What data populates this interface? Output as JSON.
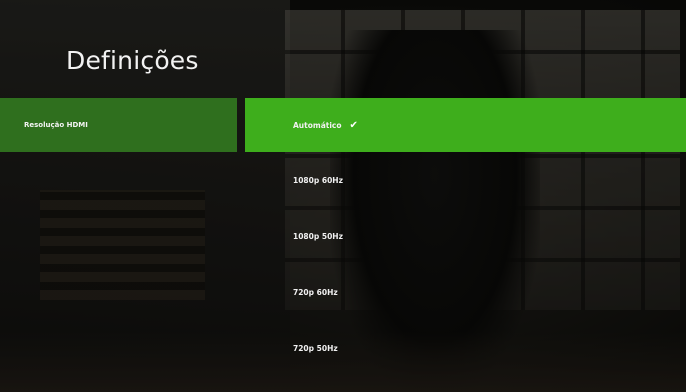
{
  "page": {
    "title": "Definições"
  },
  "settings": {
    "category_label": "Resolução HDMI"
  },
  "resolution_options": [
    {
      "label": "Automático",
      "selected": true
    },
    {
      "label": "1080p 60Hz",
      "selected": false
    },
    {
      "label": "1080p 50Hz",
      "selected": false
    },
    {
      "label": "720p 60Hz",
      "selected": false
    },
    {
      "label": "720p 50Hz",
      "selected": false
    }
  ],
  "colors": {
    "accent": "#3eae1c",
    "category_bg": "#2f6f1e"
  },
  "icons": {
    "selected": "checkmark-icon"
  }
}
